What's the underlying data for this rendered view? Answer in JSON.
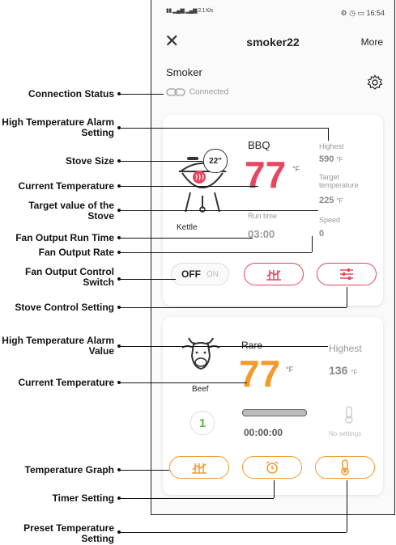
{
  "status_bar": {
    "left": "2.1 K/s",
    "time": "16:54"
  },
  "header": {
    "title": "smoker22",
    "more_label": "More"
  },
  "device": {
    "name": "Smoker",
    "connection": "Connected"
  },
  "smoker_card": {
    "stove_name": "BBQ",
    "stove_size": "22\"",
    "current_temp": "77",
    "temp_unit": "°F",
    "stove_label": "Kettle",
    "highest_label": "Highest",
    "highest_value": "590",
    "target_label": "Target temperature",
    "target_value": "225",
    "run_time_label": "Run time",
    "run_time": "03:00",
    "speed_label": "Speed",
    "speed_value": "0",
    "switch_off": "OFF",
    "switch_on": "ON"
  },
  "probe_card": {
    "doneness": "Rare",
    "highest_label": "Highest",
    "highest_value": "136",
    "current_temp": "77",
    "temp_unit": "°F",
    "meat_label": "Beef",
    "probe_number": "1",
    "timer": "00:00:00",
    "no_settings": "No settings"
  },
  "annotations": {
    "connection_status": "Connection Status",
    "high_temp_alarm_setting": "High Temperature Alarm Setting",
    "stove_size": "Stove Size",
    "current_temp_1": "Current Temperature",
    "target_value": "Target value of the Stove",
    "fan_run_time": "Fan Output Run Time",
    "fan_rate": "Fan Output Rate",
    "fan_switch": "Fan Output Control Switch",
    "stove_control": "Stove Control Setting",
    "high_temp_alarm_value": "High Temperature Alarm Value",
    "current_temp_2": "Current Temperature",
    "temp_graph": "Temperature Graph",
    "timer_setting": "Timer Setting",
    "preset_temp": "Preset Temperature Setting"
  },
  "colors": {
    "red": "#e8455f",
    "orange": "#f39a2a",
    "green": "#6ab04c"
  }
}
